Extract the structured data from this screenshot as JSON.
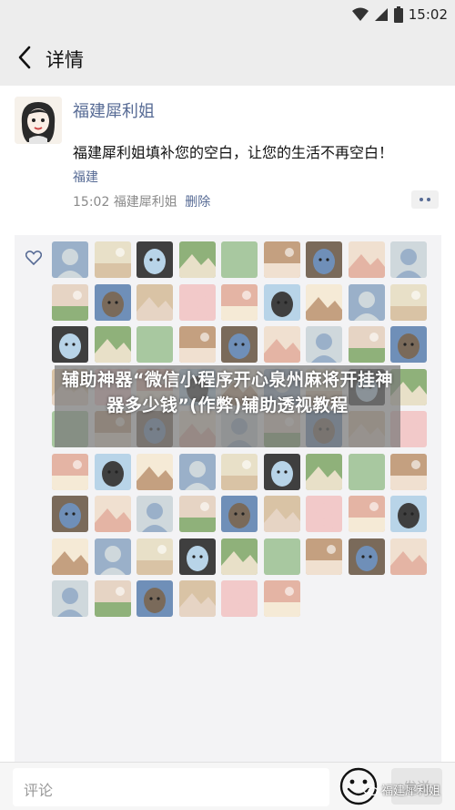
{
  "status_bar": {
    "time": "15:02",
    "icons": [
      "wifi-icon",
      "signal-icon",
      "battery-icon"
    ]
  },
  "nav": {
    "title": "详情",
    "back_icon": "chevron-left-icon"
  },
  "post": {
    "author": "福建犀利姐",
    "text": "福建犀利姐填补您的空白，让您的生活不再空白！",
    "location": "福建",
    "time": "15:02",
    "author_repeat": "福建犀利姐",
    "delete_label": "删除"
  },
  "likes": {
    "icon": "heart-outline-icon",
    "count_shown": 78
  },
  "banner": {
    "text": "辅助神器“微信小程序开心泉州麻将开挂神器多少钱”(作弊)辅助透视教程"
  },
  "comment_bar": {
    "placeholder": "评论",
    "send_label": "发送",
    "emoji_icon": "emoji-face-icon"
  },
  "watermark": {
    "text": "福建犀利姐"
  },
  "colors": {
    "link": "#576b95",
    "background": "#ededed",
    "panel": "#f3f3f5"
  }
}
